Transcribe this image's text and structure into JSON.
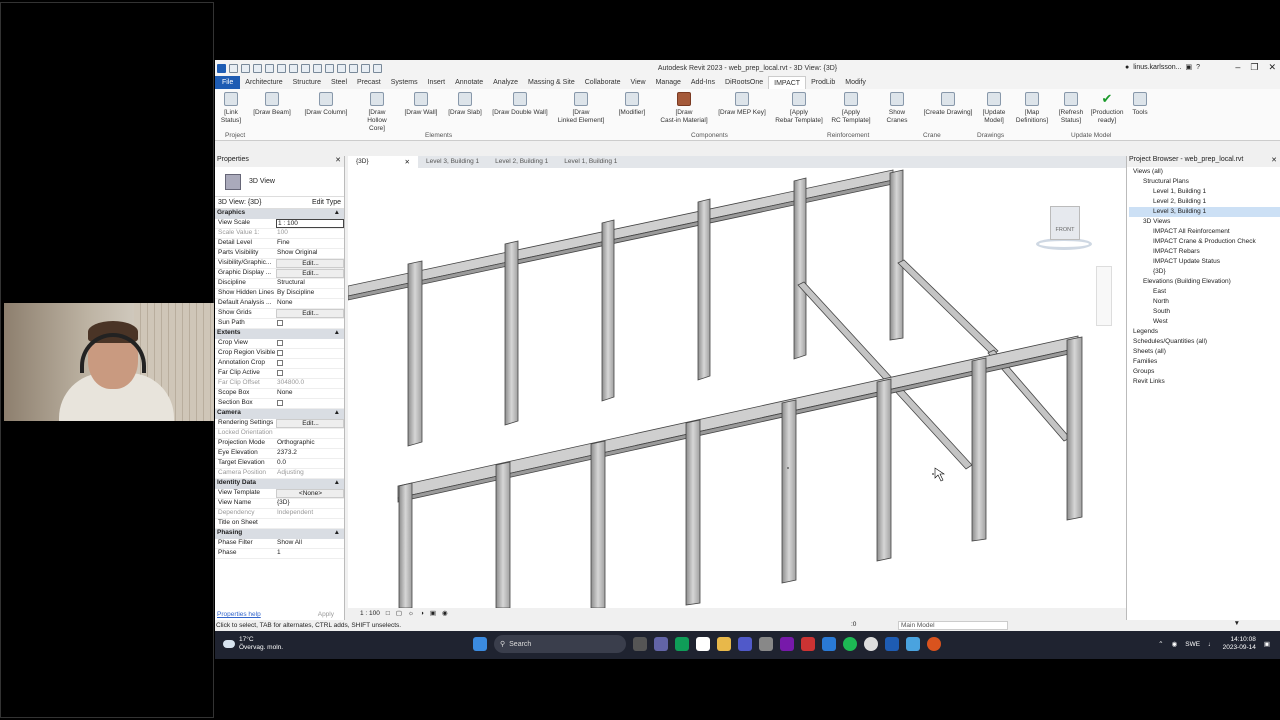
{
  "window": {
    "title": "Autodesk Revit 2023 - web_prep_local.rvt - 3D View: {3D}",
    "user": "linus.karlsson..."
  },
  "tabs": [
    "File",
    "Architecture",
    "Structure",
    "Steel",
    "Precast",
    "Systems",
    "Insert",
    "Annotate",
    "Analyze",
    "Massing & Site",
    "Collaborate",
    "View",
    "Manage",
    "Add-Ins",
    "DiRootsOne",
    "IMPACT",
    "ProdLib",
    "Modify"
  ],
  "ribbon": {
    "buttons": [
      {
        "label": "[Link\nStatus]",
        "icon": "link-icon"
      },
      {
        "label": "[Draw Beam]",
        "icon": "beam-icon"
      },
      {
        "label": "[Draw Column]",
        "icon": "column-icon"
      },
      {
        "label": "[Draw\nHollow Core]",
        "icon": "hollowcore-icon"
      },
      {
        "label": "[Draw Wall]",
        "icon": "wall-icon"
      },
      {
        "label": "[Draw Slab]",
        "icon": "slab-icon"
      },
      {
        "label": "[Draw Double Wall]",
        "icon": "doublewall-icon"
      },
      {
        "label": "[Draw\nLinked Element]",
        "icon": "linked-element-icon"
      },
      {
        "label": "[Modifier]",
        "icon": "modifier-icon"
      },
      {
        "label": "[Draw\nCast-in Material]",
        "icon": "castin-icon"
      },
      {
        "label": "[Draw MEP Key]",
        "icon": "mep-icon"
      },
      {
        "label": "[Apply\nRebar Template]",
        "icon": "rebar-icon"
      },
      {
        "label": "[Apply\nRC Template]",
        "icon": "rc-template-icon"
      },
      {
        "label": "Show Cranes",
        "icon": "crane-icon"
      },
      {
        "label": "[Create Drawing]",
        "icon": "drawing-icon"
      },
      {
        "label": "[Update\nModel]",
        "icon": "update-icon"
      },
      {
        "label": "[Map\nDefinitions]",
        "icon": "map-icon"
      },
      {
        "label": "[Refresh\nStatus]",
        "icon": "refresh-icon"
      },
      {
        "label": "[Production\nready]",
        "icon": "check-icon"
      },
      {
        "label": "Tools",
        "icon": "info-icon"
      }
    ],
    "groups": [
      "Project",
      "Elements",
      "Components",
      "Reinforcement",
      "Crane",
      "Drawings",
      "Update Model"
    ]
  },
  "properties": {
    "header": "Properties",
    "type": "3D View",
    "selector": "3D View: {3D}",
    "edit_type": "Edit Type",
    "sections": [
      {
        "name": "Graphics",
        "rows": [
          {
            "k": "View Scale",
            "v": "1 : 100",
            "kind": "input"
          },
          {
            "k": "Scale Value    1:",
            "v": "100",
            "kind": "dim"
          },
          {
            "k": "Detail Level",
            "v": "Fine"
          },
          {
            "k": "Parts Visibility",
            "v": "Show Original"
          },
          {
            "k": "Visibility/Graphic...",
            "v": "Edit...",
            "kind": "btn"
          },
          {
            "k": "Graphic Display ...",
            "v": "Edit...",
            "kind": "btn"
          },
          {
            "k": "Discipline",
            "v": "Structural"
          },
          {
            "k": "Show Hidden Lines",
            "v": "By Discipline"
          },
          {
            "k": "Default Analysis ...",
            "v": "None"
          },
          {
            "k": "Show Grids",
            "v": "Edit...",
            "kind": "btn"
          },
          {
            "k": "Sun Path",
            "v": "",
            "kind": "check"
          }
        ]
      },
      {
        "name": "Extents",
        "rows": [
          {
            "k": "Crop View",
            "v": "",
            "kind": "check"
          },
          {
            "k": "Crop Region Visible",
            "v": "",
            "kind": "check"
          },
          {
            "k": "Annotation Crop",
            "v": "",
            "kind": "check"
          },
          {
            "k": "Far Clip Active",
            "v": "",
            "kind": "check"
          },
          {
            "k": "Far Clip Offset",
            "v": "304800.0",
            "kind": "dim"
          },
          {
            "k": "Scope Box",
            "v": "None"
          },
          {
            "k": "Section Box",
            "v": "",
            "kind": "check"
          }
        ]
      },
      {
        "name": "Camera",
        "rows": [
          {
            "k": "Rendering Settings",
            "v": "Edit...",
            "kind": "btn"
          },
          {
            "k": "Locked Orientation",
            "v": "",
            "kind": "dim"
          },
          {
            "k": "Projection Mode",
            "v": "Orthographic"
          },
          {
            "k": "Eye Elevation",
            "v": "2373.2"
          },
          {
            "k": "Target Elevation",
            "v": "0.0"
          },
          {
            "k": "Camera Position",
            "v": "Adjusting",
            "kind": "dim"
          }
        ]
      },
      {
        "name": "Identity Data",
        "rows": [
          {
            "k": "View Template",
            "v": "<None>",
            "kind": "btn"
          },
          {
            "k": "View Name",
            "v": "{3D}"
          },
          {
            "k": "Dependency",
            "v": "Independent",
            "kind": "dim"
          },
          {
            "k": "Title on Sheet",
            "v": ""
          }
        ]
      },
      {
        "name": "Phasing",
        "rows": [
          {
            "k": "Phase Filter",
            "v": "Show All"
          },
          {
            "k": "Phase",
            "v": "1"
          }
        ]
      }
    ],
    "help": "Properties help",
    "apply": "Apply"
  },
  "view_tabs": [
    "{3D}",
    "Level 3, Building 1",
    "Level 2, Building 1",
    "Level 1, Building 1"
  ],
  "view_bar": {
    "scale": "1 : 100"
  },
  "viewcube": {
    "face": "FRONT"
  },
  "browser": {
    "header": "Project Browser - web_prep_local.rvt",
    "items": [
      {
        "t": "Views (all)",
        "d": 0,
        "sel": false
      },
      {
        "t": "Structural Plans",
        "d": 1,
        "sel": false
      },
      {
        "t": "Level 1, Building 1",
        "d": 2,
        "sel": false
      },
      {
        "t": "Level 2, Building 1",
        "d": 2,
        "sel": false
      },
      {
        "t": "Level 3, Building 1",
        "d": 2,
        "sel": true
      },
      {
        "t": "3D Views",
        "d": 1,
        "sel": false
      },
      {
        "t": "IMPACT All Reinforcement",
        "d": 2,
        "sel": false
      },
      {
        "t": "IMPACT Crane & Production Check",
        "d": 2,
        "sel": false
      },
      {
        "t": "IMPACT Rebars",
        "d": 2,
        "sel": false
      },
      {
        "t": "IMPACT Update Status",
        "d": 2,
        "sel": false
      },
      {
        "t": "{3D}",
        "d": 2,
        "sel": false
      },
      {
        "t": "Elevations (Building Elevation)",
        "d": 1,
        "sel": false
      },
      {
        "t": "East",
        "d": 2,
        "sel": false
      },
      {
        "t": "North",
        "d": 2,
        "sel": false
      },
      {
        "t": "South",
        "d": 2,
        "sel": false
      },
      {
        "t": "West",
        "d": 2,
        "sel": false
      },
      {
        "t": "Legends",
        "d": 0,
        "sel": false
      },
      {
        "t": "Schedules/Quantities (all)",
        "d": 0,
        "sel": false
      },
      {
        "t": "Sheets (all)",
        "d": 0,
        "sel": false
      },
      {
        "t": "Families",
        "d": 0,
        "sel": false
      },
      {
        "t": "Groups",
        "d": 0,
        "sel": false
      },
      {
        "t": "Revit Links",
        "d": 0,
        "sel": false
      }
    ]
  },
  "status": {
    "hint": "Click to select, TAB for alternates, CTRL adds, SHIFT unselects.",
    "zero": ":0",
    "model": "Main Model"
  },
  "taskbar": {
    "temp": "17°C",
    "weather": "Övervag. moln.",
    "search": "Search",
    "lang": "SWE",
    "time": "14:10:08",
    "date": "2023-09-14"
  },
  "colors": {
    "accent": "#1e5cb3",
    "taskbar": "#1f2330"
  }
}
